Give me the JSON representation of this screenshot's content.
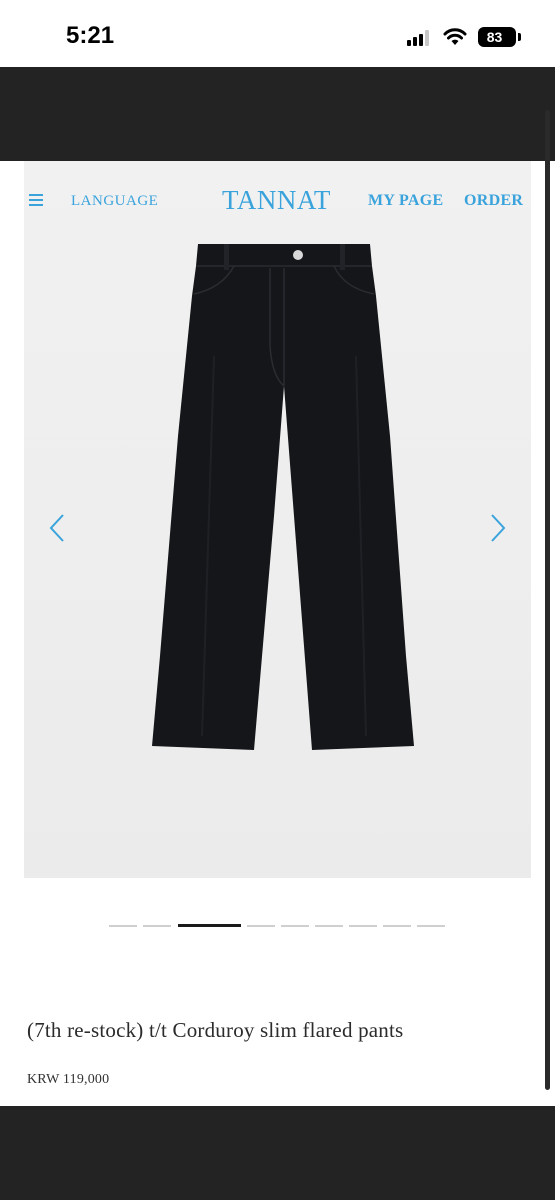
{
  "status_bar": {
    "time": "5:21",
    "battery": "83"
  },
  "nav": {
    "language": "LANGUAGE",
    "logo": "TANNAT",
    "my_page": "MY PAGE",
    "order": "ORDER"
  },
  "product": {
    "title": "(7th re-stock) t/t Corduroy slim flared pants",
    "price": "KRW 119,000"
  },
  "gallery": {
    "image_count": 9,
    "current_index": 3
  },
  "colors": {
    "accent": "#3aa3dc",
    "frame": "#232323",
    "pants": "#15161a"
  },
  "icons": [
    "menu-icon",
    "chevron-left-icon",
    "chevron-right-icon",
    "signal-icon",
    "wifi-icon",
    "battery-icon"
  ]
}
